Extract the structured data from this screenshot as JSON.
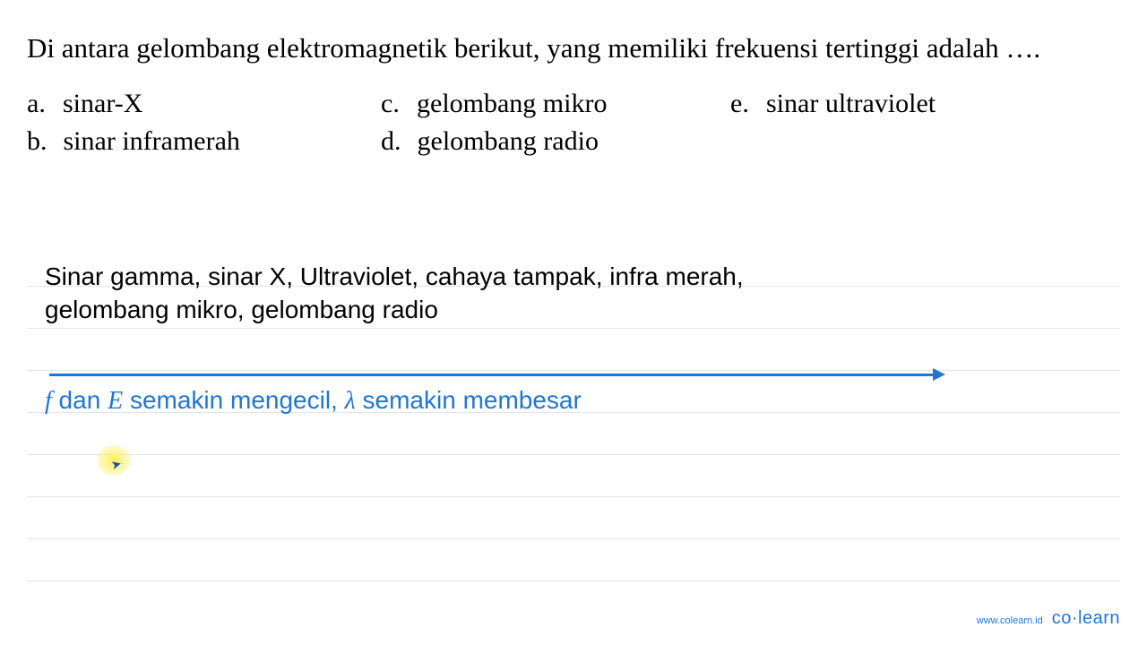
{
  "question": {
    "text": "Di antara gelombang elektromagnetik berikut,  yang memiliki frekuensi tertinggi adalah …."
  },
  "options": {
    "a": {
      "label": "a.",
      "text": "sinar-X"
    },
    "b": {
      "label": "b.",
      "text": "sinar inframerah"
    },
    "c": {
      "label": "c.",
      "text": "gelombang mikro"
    },
    "d": {
      "label": "d.",
      "text": "gelombang radio"
    },
    "e": {
      "label": "e.",
      "text": "sinar ultraviolet"
    }
  },
  "answer": {
    "line1": "Sinar gamma, sinar X, Ultraviolet, cahaya tampak, infra merah,",
    "line2": "gelombang mikro, gelombang radio"
  },
  "explanation": {
    "f": "f",
    "dan": " dan ",
    "E": "E",
    "part1": " semakin mengecil, ",
    "lambda": "λ",
    "part2": " semakin membesar"
  },
  "footer": {
    "url": "www.colearn.id",
    "logo": "co·learn"
  }
}
